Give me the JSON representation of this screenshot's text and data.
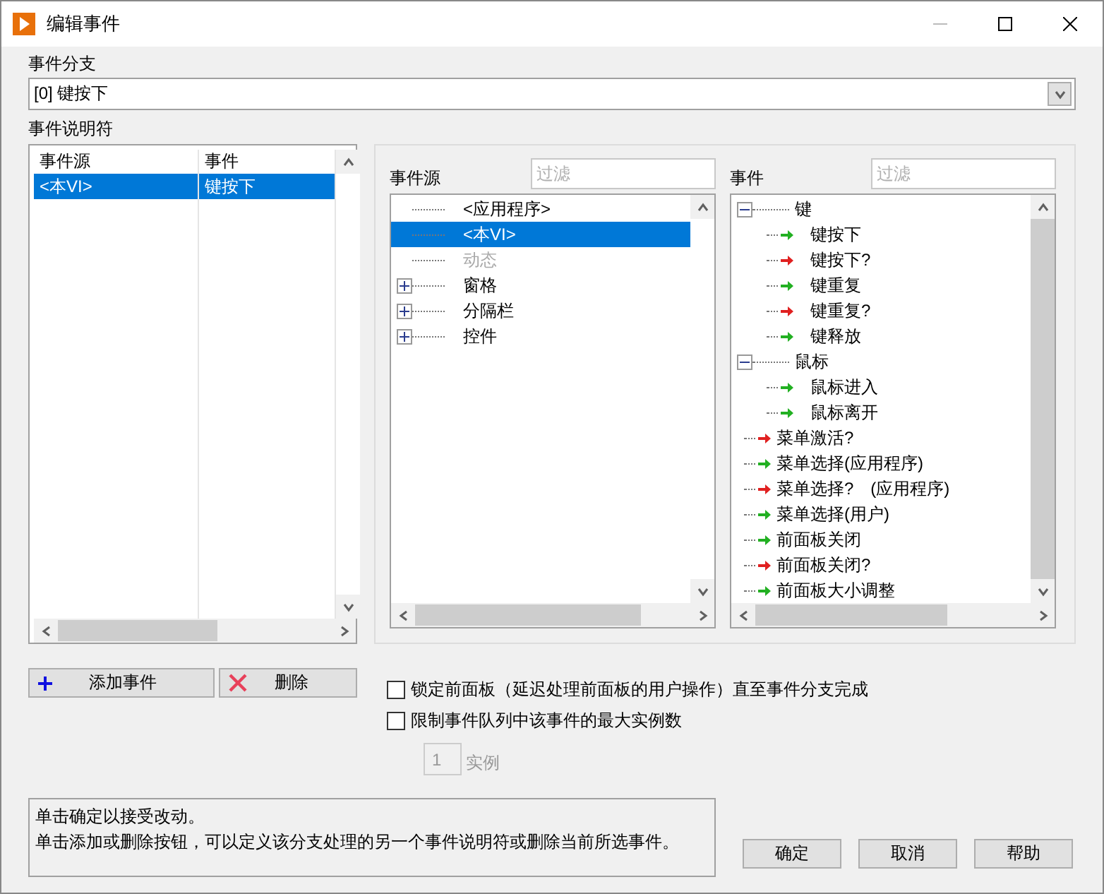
{
  "window": {
    "title": "编辑事件"
  },
  "event_case": {
    "label": "事件分支",
    "value": "[0] 键按下"
  },
  "event_specifiers": {
    "label": "事件说明符",
    "columns": [
      "事件源",
      "事件"
    ],
    "rows": [
      {
        "source": "<本VI>",
        "event": "键按下",
        "selected": true
      }
    ]
  },
  "event_sources": {
    "label": "事件源",
    "filter_placeholder": "过滤",
    "items": [
      {
        "label": "<应用程序>",
        "kind": "item",
        "selected": false,
        "disabled": false
      },
      {
        "label": "<本VI>",
        "kind": "item",
        "selected": true,
        "disabled": false
      },
      {
        "label": "动态",
        "kind": "item",
        "selected": false,
        "disabled": true
      },
      {
        "label": "窗格",
        "kind": "group",
        "expanded": false,
        "selected": false,
        "disabled": false
      },
      {
        "label": "分隔栏",
        "kind": "group",
        "expanded": false,
        "selected": false,
        "disabled": false
      },
      {
        "label": "控件",
        "kind": "group",
        "expanded": false,
        "selected": false,
        "disabled": false
      }
    ]
  },
  "events": {
    "label": "事件",
    "filter_placeholder": "过滤",
    "items": [
      {
        "label": "键",
        "kind": "group",
        "expanded": true,
        "children": [
          {
            "label": "键按下",
            "kind": "item",
            "color": "#22b022"
          },
          {
            "label": "键按下?",
            "kind": "item",
            "color": "#e02020"
          },
          {
            "label": "键重复",
            "kind": "item",
            "color": "#22b022"
          },
          {
            "label": "键重复?",
            "kind": "item",
            "color": "#e02020"
          },
          {
            "label": "键释放",
            "kind": "item",
            "color": "#22b022"
          }
        ]
      },
      {
        "label": "鼠标",
        "kind": "group",
        "expanded": true,
        "children": [
          {
            "label": "鼠标进入",
            "kind": "item",
            "color": "#22b022"
          },
          {
            "label": "鼠标离开",
            "kind": "item",
            "color": "#22b022"
          }
        ]
      },
      {
        "label": "菜单激活?",
        "kind": "item",
        "color": "#e02020"
      },
      {
        "label": "菜单选择(应用程序)",
        "kind": "item",
        "color": "#22b022"
      },
      {
        "label": "菜单选择?　(应用程序)",
        "kind": "item",
        "color": "#e02020"
      },
      {
        "label": "菜单选择(用户)",
        "kind": "item",
        "color": "#22b022"
      },
      {
        "label": "前面板关闭",
        "kind": "item",
        "color": "#22b022"
      },
      {
        "label": "前面板关闭?",
        "kind": "item",
        "color": "#e02020"
      },
      {
        "label": "前面板大小调整",
        "kind": "item",
        "color": "#22b022"
      }
    ]
  },
  "actions": [
    {
      "label": "添加事件",
      "kind": "add"
    },
    {
      "label": "删除",
      "kind": "delete"
    }
  ],
  "options": [
    {
      "label": "锁定前面板（延迟处理前面板的用户操作）直至事件分支完成",
      "checked": false
    },
    {
      "label": "限制事件队列中该事件的最大实例数",
      "checked": false
    }
  ],
  "instances": {
    "value": "1",
    "label": "实例",
    "disabled": true
  },
  "info": [
    "单击确定以接受改动。",
    "单击添加或删除按钮，可以定义该分支处理的另一个事件说明符或删除当前所选事件。"
  ],
  "buttons": [
    "确定",
    "取消",
    "帮助"
  ]
}
